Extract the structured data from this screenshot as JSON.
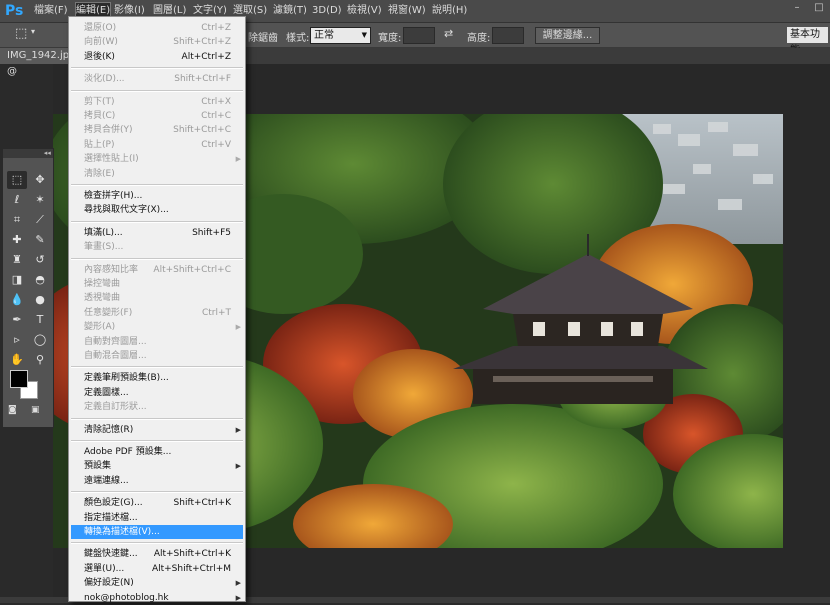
{
  "app": {
    "logo": "Ps"
  },
  "menubar": {
    "items": [
      "檔案(F)",
      "編輯(E)",
      "影像(I)",
      "圖層(L)",
      "文字(Y)",
      "選取(S)",
      "濾鏡(T)",
      "3D(D)",
      "檢視(V)",
      "視窗(W)",
      "說明(H)"
    ],
    "active_index": 1
  },
  "window_controls": {
    "minimize": "–",
    "restore": "□"
  },
  "options_bar": {
    "style_label": "樣式:",
    "style_value": "正常",
    "width_label": "寬度:",
    "height_label": "高度:",
    "swap_icon": "swap-arrows-icon",
    "refine_button": "調整邊緣...",
    "partial_label": "除鋸齒",
    "workspace_button": "基本功能"
  },
  "document_tab": {
    "title": "IMG_1942.jpg @"
  },
  "edit_menu": {
    "highlight_color": "#3399ff",
    "items": [
      {
        "label": "還原(O)",
        "shortcut": "Ctrl+Z",
        "disabled": true
      },
      {
        "label": "向前(W)",
        "shortcut": "Shift+Ctrl+Z",
        "disabled": true
      },
      {
        "label": "退後(K)",
        "shortcut": "Alt+Ctrl+Z",
        "disabled": false
      },
      {
        "sep": true
      },
      {
        "label": "淡化(D)...",
        "shortcut": "Shift+Ctrl+F",
        "disabled": true
      },
      {
        "sep": true
      },
      {
        "label": "剪下(T)",
        "shortcut": "Ctrl+X",
        "disabled": true
      },
      {
        "label": "拷貝(C)",
        "shortcut": "Ctrl+C",
        "disabled": true
      },
      {
        "label": "拷貝合併(Y)",
        "shortcut": "Shift+Ctrl+C",
        "disabled": true
      },
      {
        "label": "貼上(P)",
        "shortcut": "Ctrl+V",
        "disabled": true
      },
      {
        "label": "選擇性貼上(I)",
        "shortcut": "",
        "submenu": true,
        "disabled": true
      },
      {
        "label": "清除(E)",
        "shortcut": "",
        "disabled": true
      },
      {
        "sep": true
      },
      {
        "label": "檢查拼字(H)...",
        "shortcut": "",
        "disabled": false
      },
      {
        "label": "尋找與取代文字(X)...",
        "shortcut": "",
        "disabled": false
      },
      {
        "sep": true
      },
      {
        "label": "填滿(L)...",
        "shortcut": "Shift+F5",
        "disabled": false
      },
      {
        "label": "筆畫(S)...",
        "shortcut": "",
        "disabled": true
      },
      {
        "sep": true
      },
      {
        "label": "內容感知比率",
        "shortcut": "Alt+Shift+Ctrl+C",
        "disabled": true
      },
      {
        "label": "操控彎曲",
        "shortcut": "",
        "disabled": true
      },
      {
        "label": "透視彎曲",
        "shortcut": "",
        "disabled": true
      },
      {
        "label": "任意變形(F)",
        "shortcut": "Ctrl+T",
        "disabled": true
      },
      {
        "label": "變形(A)",
        "shortcut": "",
        "submenu": true,
        "disabled": true
      },
      {
        "label": "自動對齊圖層...",
        "shortcut": "",
        "disabled": true
      },
      {
        "label": "自動混合圖層...",
        "shortcut": "",
        "disabled": true
      },
      {
        "sep": true
      },
      {
        "label": "定義筆刷預設集(B)...",
        "shortcut": "",
        "disabled": false
      },
      {
        "label": "定義圖樣...",
        "shortcut": "",
        "disabled": false
      },
      {
        "label": "定義自訂形狀...",
        "shortcut": "",
        "disabled": true
      },
      {
        "sep": true
      },
      {
        "label": "清除記憶(R)",
        "shortcut": "",
        "submenu": true,
        "disabled": false
      },
      {
        "sep": true
      },
      {
        "label": "Adobe PDF 預設集...",
        "shortcut": "",
        "disabled": false
      },
      {
        "label": "預設集",
        "shortcut": "",
        "submenu": true,
        "disabled": false
      },
      {
        "label": "遠端連線...",
        "shortcut": "",
        "disabled": false
      },
      {
        "sep": true
      },
      {
        "label": "顏色設定(G)...",
        "shortcut": "Shift+Ctrl+K",
        "disabled": false
      },
      {
        "label": "指定描述檔...",
        "shortcut": "",
        "disabled": false
      },
      {
        "label": "轉換為描述檔(V)...",
        "shortcut": "",
        "disabled": false,
        "highlighted": true
      },
      {
        "sep": true
      },
      {
        "label": "鍵盤快速鍵...",
        "shortcut": "Alt+Shift+Ctrl+K",
        "disabled": false
      },
      {
        "label": "選單(U)...",
        "shortcut": "Alt+Shift+Ctrl+M",
        "disabled": false
      },
      {
        "label": "偏好設定(N)",
        "shortcut": "",
        "submenu": true,
        "disabled": false
      },
      {
        "label": "nok@photoblog.hk",
        "shortcut": "",
        "submenu": true,
        "disabled": false
      }
    ]
  },
  "tools": [
    {
      "name": "marquee-tool-icon",
      "glyph": "⬚"
    },
    {
      "name": "move-tool-icon",
      "glyph": "✥"
    },
    {
      "name": "lasso-tool-icon",
      "glyph": "ℓ"
    },
    {
      "name": "magic-wand-icon",
      "glyph": "✶"
    },
    {
      "name": "crop-tool-icon",
      "glyph": "⌗"
    },
    {
      "name": "eyedropper-icon",
      "glyph": "⟋"
    },
    {
      "name": "healing-brush-icon",
      "glyph": "✚"
    },
    {
      "name": "brush-tool-icon",
      "glyph": "✎"
    },
    {
      "name": "stamp-tool-icon",
      "glyph": "♜"
    },
    {
      "name": "history-brush-icon",
      "glyph": "↺"
    },
    {
      "name": "eraser-tool-icon",
      "glyph": "◨"
    },
    {
      "name": "paint-bucket-icon",
      "glyph": "◓"
    },
    {
      "name": "blur-tool-icon",
      "glyph": "💧"
    },
    {
      "name": "dodge-tool-icon",
      "glyph": "●"
    },
    {
      "name": "pen-tool-icon",
      "glyph": "✒"
    },
    {
      "name": "type-tool-icon",
      "glyph": "T"
    },
    {
      "name": "path-select-icon",
      "glyph": "▹"
    },
    {
      "name": "shape-tool-icon",
      "glyph": "◯"
    },
    {
      "name": "hand-tool-icon",
      "glyph": "✋"
    },
    {
      "name": "zoom-tool-icon",
      "glyph": "⚲"
    }
  ]
}
